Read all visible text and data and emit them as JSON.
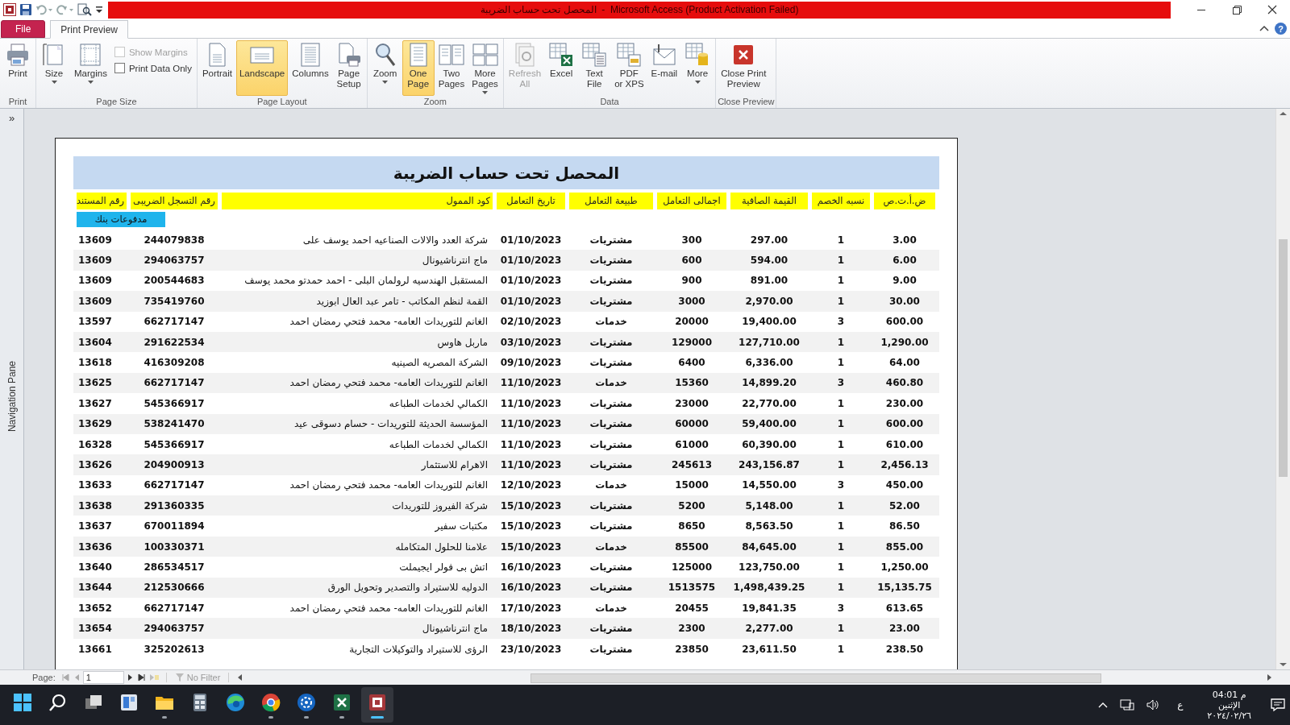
{
  "window": {
    "title": "المحصل تحت حساب الضريبة  -  Microsoft Access (Product Activation Failed)"
  },
  "ribbon_tabs": [
    {
      "label": "File",
      "kind": "file",
      "selected": false
    },
    {
      "label": "Print Preview",
      "kind": "tab",
      "selected": true
    }
  ],
  "help": {
    "label": "?"
  },
  "ribbon_groups": [
    {
      "title": "Print",
      "controls": [
        {
          "kind": "large",
          "label": "Print",
          "selected": false,
          "disabled": false
        }
      ]
    },
    {
      "title": "Page Size",
      "controls": [
        {
          "kind": "large",
          "label": "Size",
          "dropdown": true,
          "selected": false,
          "disabled": false
        },
        {
          "kind": "large",
          "label": "Margins",
          "dropdown": true,
          "selected": false,
          "disabled": false
        },
        {
          "kind": "checkbox",
          "label": "Show Margins",
          "checked": false,
          "disabled": true
        },
        {
          "kind": "checkbox",
          "label": "Print Data Only",
          "checked": false,
          "disabled": false
        }
      ]
    },
    {
      "title": "Page Layout",
      "controls": [
        {
          "kind": "large",
          "label": "Portrait",
          "selected": false,
          "disabled": false
        },
        {
          "kind": "large",
          "label": "Landscape",
          "selected": true,
          "disabled": false
        },
        {
          "kind": "large",
          "label": "Columns",
          "selected": false,
          "disabled": false
        },
        {
          "kind": "large",
          "label": "Page\nSetup",
          "selected": false,
          "disabled": false
        }
      ]
    },
    {
      "title": "Zoom",
      "controls": [
        {
          "kind": "large",
          "label": "Zoom",
          "dropdown": true,
          "selected": false,
          "disabled": false
        },
        {
          "kind": "large",
          "label": "One\nPage",
          "selected": true,
          "disabled": false
        },
        {
          "kind": "large",
          "label": "Two\nPages",
          "selected": false,
          "disabled": false
        },
        {
          "kind": "large",
          "label": "More\nPages",
          "dropdown": true,
          "selected": false,
          "disabled": false
        }
      ]
    },
    {
      "title": "Data",
      "controls": [
        {
          "kind": "large",
          "label": "Refresh\nAll",
          "selected": false,
          "disabled": true
        },
        {
          "kind": "large",
          "label": "Excel",
          "selected": false,
          "disabled": false
        },
        {
          "kind": "large",
          "label": "Text\nFile",
          "selected": false,
          "disabled": false
        },
        {
          "kind": "large",
          "label": "PDF\nor XPS",
          "selected": false,
          "disabled": false
        },
        {
          "kind": "large",
          "label": "E-mail",
          "selected": false,
          "disabled": false
        },
        {
          "kind": "large",
          "label": "More",
          "dropdown": true,
          "selected": false,
          "disabled": false
        }
      ]
    },
    {
      "title": "Close Preview",
      "controls": [
        {
          "kind": "large",
          "label": "Close Print\nPreview",
          "selected": false,
          "disabled": false
        }
      ]
    }
  ],
  "navigation_pane": {
    "toggle": "»",
    "label": "Navigation Pane"
  },
  "report": {
    "title": "المحصل تحت حساب الضريبة",
    "columns": [
      "رقم المستند",
      "رقم التسجل الضريبى",
      "كود الممول",
      "تاريخ التعامل",
      "طبيعة التعامل",
      "اجمالى التعامل",
      "القيمة الصافية",
      "نسبه الخصم",
      "ض.أ.ت.ص"
    ],
    "group_label": "مدفوعات بنك",
    "rows": [
      [
        "13609",
        "244079838",
        "شركة العدد والالات الصناعيه احمد يوسف على",
        "01/10/2023",
        "مشتريات",
        "300",
        "297.00",
        "1",
        "3.00"
      ],
      [
        "13609",
        "294063757",
        "ماج انترناشيونال",
        "01/10/2023",
        "مشتريات",
        "600",
        "594.00",
        "1",
        "6.00"
      ],
      [
        "13609",
        "200544683",
        "المستقبل الهندسيه لرولمان البلى  - احمد حمدتو محمد يوسف",
        "01/10/2023",
        "مشتريات",
        "900",
        "891.00",
        "1",
        "9.00"
      ],
      [
        "13609",
        "735419760",
        "القمة لنظم المكاتب - تامر عبد العال ابوزيد",
        "01/10/2023",
        "مشتريات",
        "3000",
        "2,970.00",
        "1",
        "30.00"
      ],
      [
        "13597",
        "662717147",
        "الغانم للتوريدات العامه- محمد فتحي رمضان احمد",
        "02/10/2023",
        "خدمات",
        "20000",
        "19,400.00",
        "3",
        "600.00"
      ],
      [
        "13604",
        "291622534",
        "ماربل هاوس",
        "03/10/2023",
        "مشتريات",
        "129000",
        "127,710.00",
        "1",
        "1,290.00"
      ],
      [
        "13618",
        "416309208",
        "الشركة المصريه الصينيه",
        "09/10/2023",
        "مشتريات",
        "6400",
        "6,336.00",
        "1",
        "64.00"
      ],
      [
        "13625",
        "662717147",
        "الغانم للتوريدات العامه- محمد فتحي رمضان احمد",
        "11/10/2023",
        "خدمات",
        "15360",
        "14,899.20",
        "3",
        "460.80"
      ],
      [
        "13627",
        "545366917",
        "الكمالي لخدمات الطباعه",
        "11/10/2023",
        "مشتريات",
        "23000",
        "22,770.00",
        "1",
        "230.00"
      ],
      [
        "13629",
        "538241470",
        "المؤسسة الحديثة للتوريدات - حسام دسوقى عيد",
        "11/10/2023",
        "مشتريات",
        "60000",
        "59,400.00",
        "1",
        "600.00"
      ],
      [
        "16328",
        "545366917",
        "الكمالي لخدمات الطباعه",
        "11/10/2023",
        "مشتريات",
        "61000",
        "60,390.00",
        "1",
        "610.00"
      ],
      [
        "13626",
        "204900913",
        "الاهرام للاستثمار",
        "11/10/2023",
        "مشتريات",
        "245613",
        "243,156.87",
        "1",
        "2,456.13"
      ],
      [
        "13633",
        "662717147",
        "الغانم للتوريدات العامه- محمد فتحي رمضان احمد",
        "12/10/2023",
        "خدمات",
        "15000",
        "14,550.00",
        "3",
        "450.00"
      ],
      [
        "13638",
        "291360335",
        "شركة الفيروز للتوريدات",
        "15/10/2023",
        "مشتريات",
        "5200",
        "5,148.00",
        "1",
        "52.00"
      ],
      [
        "13637",
        "670011894",
        "مكتبات سفير",
        "15/10/2023",
        "مشتريات",
        "8650",
        "8,563.50",
        "1",
        "86.50"
      ],
      [
        "13636",
        "100330371",
        "علامنا للحلول المتكامله",
        "15/10/2023",
        "خدمات",
        "85500",
        "84,645.00",
        "1",
        "855.00"
      ],
      [
        "13640",
        "286534517",
        "اتش بى فولر ايجيملت",
        "16/10/2023",
        "مشتريات",
        "125000",
        "123,750.00",
        "1",
        "1,250.00"
      ],
      [
        "13644",
        "212530666",
        "الدوليه للاستيراد والتصدير وتحويل الورق",
        "16/10/2023",
        "مشتريات",
        "1513575",
        "1,498,439.25",
        "1",
        "15,135.75"
      ],
      [
        "13652",
        "662717147",
        "الغانم للتوريدات العامه- محمد فتحي رمضان احمد",
        "17/10/2023",
        "خدمات",
        "20455",
        "19,841.35",
        "3",
        "613.65"
      ],
      [
        "13654",
        "294063757",
        "ماج انترناشيونال",
        "18/10/2023",
        "مشتريات",
        "2300",
        "2,277.00",
        "1",
        "23.00"
      ],
      [
        "13661",
        "325202613",
        "الرؤى للاستيراد والتوكيلات التجارية",
        "23/10/2023",
        "مشتريات",
        "23850",
        "23,611.50",
        "1",
        "238.50"
      ]
    ]
  },
  "status_bar": {
    "page_label": "Page:",
    "page_value": "1",
    "filter": "No Filter"
  },
  "taskbar": {
    "apps": [
      {
        "running": false,
        "active": false
      },
      {
        "running": false,
        "active": false
      },
      {
        "running": false,
        "active": false
      },
      {
        "running": false,
        "active": false
      },
      {
        "running": true,
        "active": false
      },
      {
        "running": false,
        "active": false
      },
      {
        "running": false,
        "active": false
      },
      {
        "running": true,
        "active": false
      },
      {
        "running": true,
        "active": false
      },
      {
        "running": true,
        "active": false
      },
      {
        "running": true,
        "active": true
      }
    ],
    "language": "ع",
    "time": "04:01 م",
    "day": "الإثنين",
    "date": "٢٠٢٤/٠٢/٢٦"
  }
}
